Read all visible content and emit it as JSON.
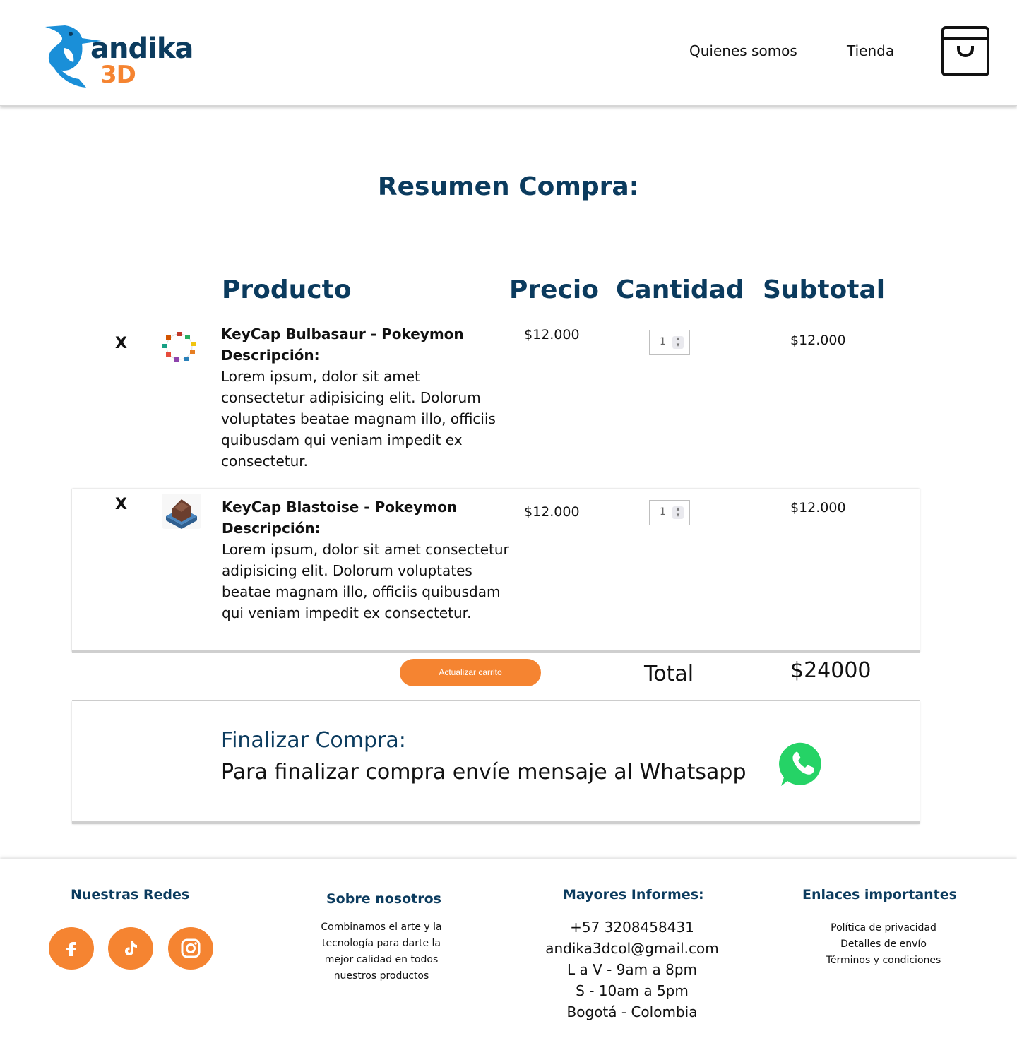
{
  "brand": {
    "name_line1": "andika",
    "name_line2": "3D"
  },
  "nav": {
    "items": [
      "Quienes somos",
      "Tienda"
    ]
  },
  "page": {
    "title": "Resumen Compra:"
  },
  "table": {
    "headers": {
      "product": "Producto",
      "price": "Precio",
      "quantity": "Cantidad",
      "subtotal": "Subtotal"
    },
    "rows": [
      {
        "remove": "X",
        "name": "KeyCap Bulbasaur - Pokeymon",
        "desc_label": "Descripción:",
        "desc": "Lorem ipsum, dolor sit amet consectetur adipisicing elit. Dolorum voluptates beatae magnam illo, officiis quibusdam qui veniam impedit ex consectetur.",
        "price": "$12.000",
        "quantity": "1",
        "subtotal": "$12.000"
      },
      {
        "remove": "X",
        "name": "KeyCap Blastoise - Pokeymon",
        "desc_label": "Descripción:",
        "desc": "Lorem ipsum, dolor sit amet consectetur adipisicing elit. Dolorum  voluptates beatae magnam illo, officiis quibusdam qui veniam impedit ex consectetur.",
        "price": "$12.000",
        "quantity": "1",
        "subtotal": "$12.000"
      }
    ]
  },
  "cart": {
    "update_label": "Actualizar carrito",
    "total_label": "Total",
    "total_value": "$24000"
  },
  "checkout": {
    "title": "Finalizar Compra:",
    "message": "Para finalizar compra envíe mensaje al Whatsapp"
  },
  "footer": {
    "social_title": "Nuestras Redes",
    "about_title": "Sobre nosotros",
    "about_text": "Combinamos el arte y la tecnología para darte la mejor calidad en todos nuestros productos",
    "contact_title": "Mayores Informes:",
    "contact": [
      "+57 3208458431",
      "andika3dcol@gmail.com",
      "L a V - 9am a 8pm",
      "S - 10am a 5pm",
      "Bogotá - Colombia"
    ],
    "links_title": "Enlaces importantes",
    "links": [
      "Política de privacidad",
      "Detalles de envío",
      "Términos y condiciones"
    ]
  },
  "colors": {
    "brand_navy": "#0b3b5e",
    "brand_orange": "#f58431",
    "whatsapp_green": "#25d366"
  },
  "icons": {
    "cart": "shopping-bag-icon",
    "social": [
      "facebook-icon",
      "tiktok-icon",
      "instagram-icon"
    ],
    "checkout": "whatsapp-icon"
  }
}
